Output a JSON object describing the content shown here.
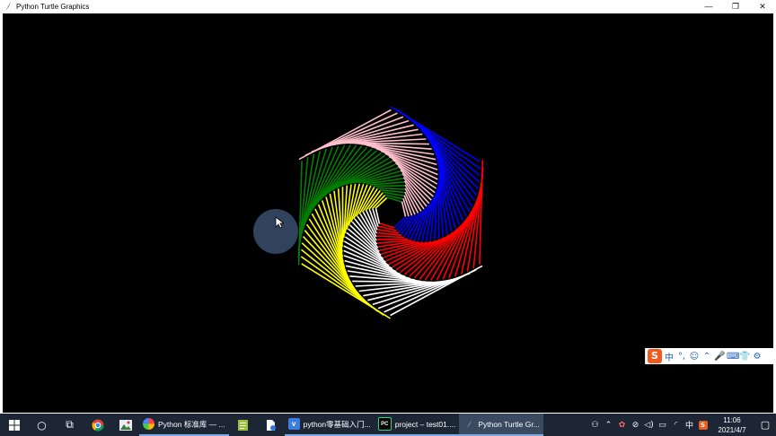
{
  "window": {
    "title": "Python Turtle Graphics",
    "controls": [
      "minimize-icon",
      "restore-icon",
      "close-icon"
    ],
    "minimize_glyph": "—",
    "restore_glyph": "❐",
    "close_glyph": "✕"
  },
  "canvas": {
    "background": "#000000",
    "spiral": {
      "colors": [
        "#ff0000",
        "#ffffff",
        "#ffff00",
        "#008000",
        "#ffc0cb",
        "#0000ff"
      ],
      "sides": 6,
      "segments": 30
    }
  },
  "ime": {
    "logo": "S",
    "items": [
      "中",
      "°,",
      "☺",
      "⌃",
      "🎤",
      "⌨",
      "👕",
      "⚙"
    ]
  },
  "taskbar": {
    "start_icon": "windows-start-icon",
    "search_glyph": "○",
    "taskview_glyph": "⧉",
    "apps": [
      {
        "label": "Python 标准库 — ...",
        "icon_color": "#e8a33b",
        "icon_text": "",
        "active": false
      },
      {
        "label": "python零基础入门...",
        "icon_color": "#3c7be0",
        "icon_text": "v",
        "active": false
      },
      {
        "label": "project – test01....",
        "icon_color": "#21d789",
        "icon_text": "PC",
        "active": false
      },
      {
        "label": "Python Turtle Gr...",
        "icon_color": "#3a4a60",
        "icon_text": "",
        "active": true
      }
    ],
    "tray": {
      "icons": [
        "person-icon",
        "chevron-up-icon",
        "flower-icon",
        "wifi-off-icon",
        "volume-icon",
        "battery-icon",
        "network-icon"
      ],
      "ime_label": "中",
      "sogou_label": "S",
      "time": "11:06",
      "date": "2021/4/7"
    }
  }
}
